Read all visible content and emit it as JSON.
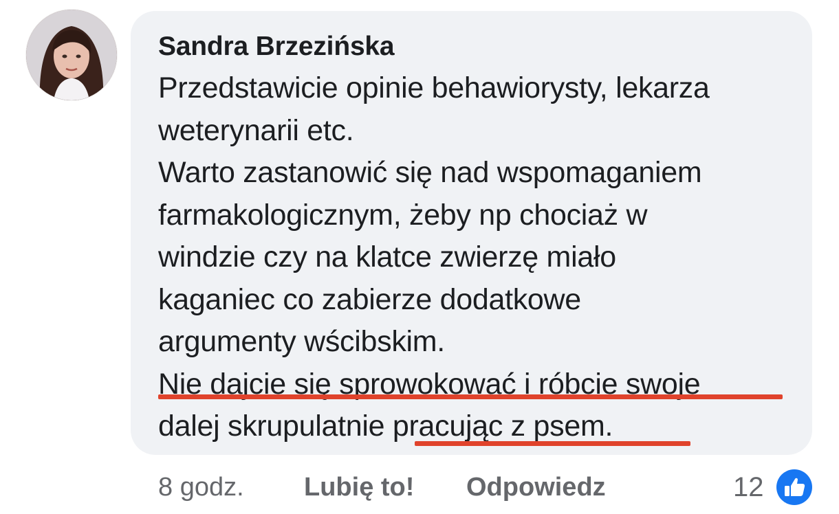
{
  "comment": {
    "author": "Sandra Brzezińska",
    "lines": [
      "Przedstawicie opinie behawiorysty, lekarza",
      "weterynarii etc.",
      "Warto zastanowić się nad wspomaganiem",
      "farmakologicznym, żeby np chociaż w",
      "windzie czy na klatce zwierzę miało",
      "kaganiec co zabierze dodatkowe",
      "argumenty wścibskim.",
      "Nie dajcie się sprowokować i róbcie swoje",
      "dalej skrupulatnie pracując z psem."
    ],
    "highlighted_phrases": [
      "Nie dajcie się sprowokować i róbcie swoje",
      "pracując z psem."
    ],
    "highlight_color": "#e0432c"
  },
  "actions": {
    "time": "8 godz.",
    "like_label": "Lubię to!",
    "reply_label": "Odpowiedz"
  },
  "reactions": {
    "count": "12",
    "icon": "thumbs-up-icon",
    "color": "#1877f2"
  },
  "colors": {
    "bubble": "#f0f2f5",
    "text": "#1c1e21",
    "meta": "#65676b"
  }
}
